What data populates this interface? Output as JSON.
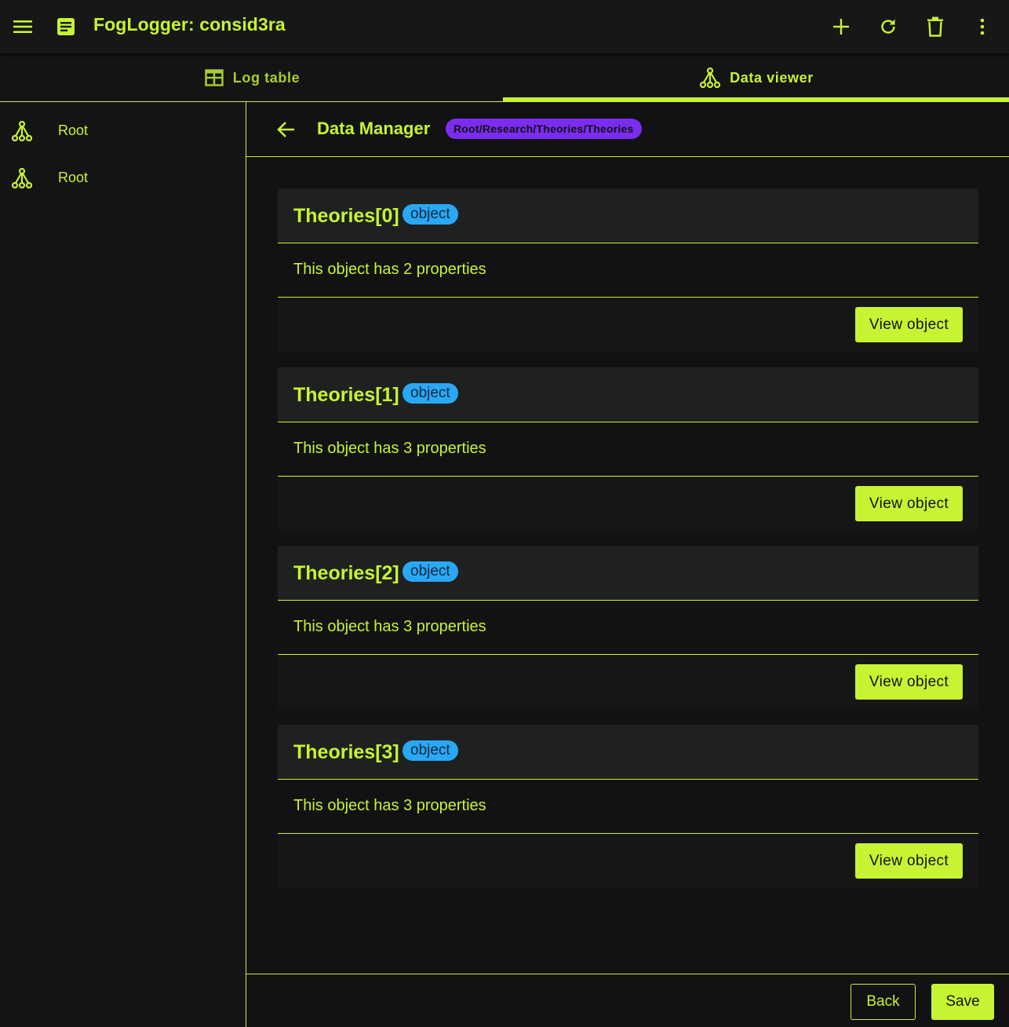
{
  "appbar": {
    "title": "FogLogger: consid3ra",
    "icons": [
      "menu-icon",
      "document-icon",
      "add-icon",
      "refresh-icon",
      "delete-icon",
      "more-vert-icon"
    ]
  },
  "tabs": [
    {
      "label": "Log table",
      "icon": "table-icon",
      "active": false
    },
    {
      "label": "Data viewer",
      "icon": "tree-icon",
      "active": true
    }
  ],
  "sidebar": {
    "items": [
      {
        "label": "Root",
        "icon": "tree-icon"
      },
      {
        "label": "Root",
        "icon": "tree-icon"
      }
    ]
  },
  "main": {
    "title": "Data Manager",
    "path": "Root/Research/Theories/Theories",
    "cards": [
      {
        "title": "Theories[0]",
        "type": "object",
        "description": "This object has 2 properties",
        "button": "View object"
      },
      {
        "title": "Theories[1]",
        "type": "object",
        "description": "This object has 3 properties",
        "button": "View object"
      },
      {
        "title": "Theories[2]",
        "type": "object",
        "description": "This object has 3 properties",
        "button": "View object"
      },
      {
        "title": "Theories[3]",
        "type": "object",
        "description": "This object has 3 properties",
        "button": "View object"
      }
    ],
    "footer": {
      "back_label": "Back",
      "save_label": "Save"
    }
  },
  "colors": {
    "accent": "#c6f432",
    "path_chip": "#7c2cf0",
    "type_chip": "#29a8f5",
    "background": "#121212"
  }
}
